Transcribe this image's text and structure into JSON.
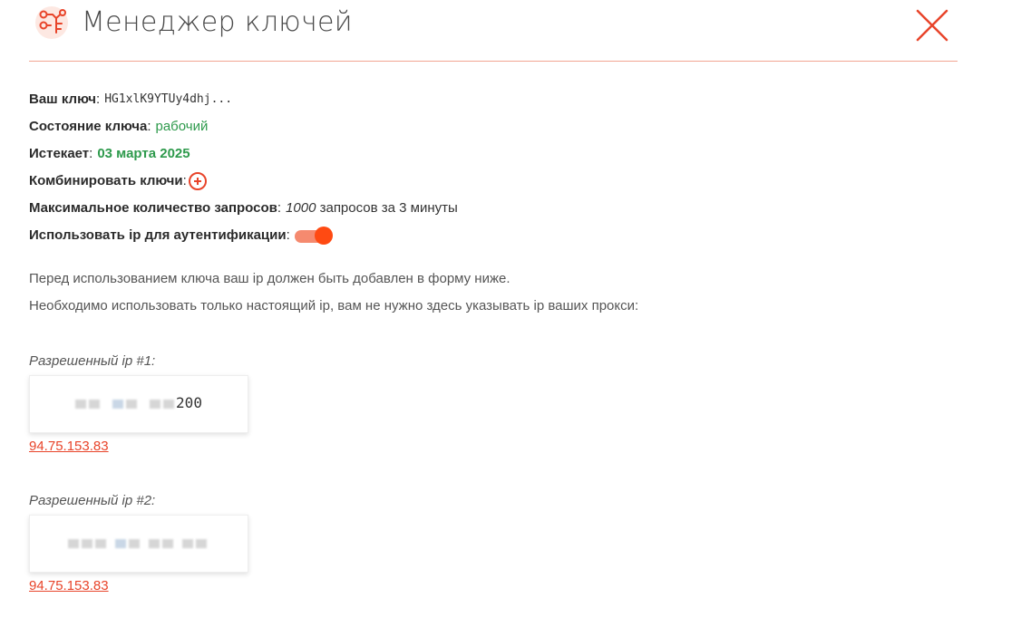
{
  "header": {
    "title": "Менеджер ключей",
    "logo_icon": "key-circuit-icon",
    "close_icon": "close-x-icon",
    "accent_color": "#e8442a"
  },
  "key_info": {
    "key_label": "Ваш ключ",
    "key_value": "HG1xlK9YTUy4dhj...",
    "state_label": "Состояние ключа",
    "state_value": "рабочий",
    "expires_label": "Истекает",
    "expires_value": "03 марта 2025",
    "combine_label": "Комбинировать ключи",
    "combine_icon": "plus-circle-icon",
    "max_label": "Максимальное количество запросов",
    "max_count": "1000",
    "max_rest": "запросов за 3 минуты",
    "ip_auth_label": "Использовать ip для аутентификации",
    "ip_auth_enabled": true
  },
  "notes": {
    "line1": "Перед использованием ключа ваш ip должен быть добавлен в форму ниже.",
    "line2": "Необходимо использовать только настоящий ip, вам не нужно здесь указывать ip ваших прокси:"
  },
  "allowed_ips": [
    {
      "label": "Разрешенный ip #1:",
      "value_visible": "200",
      "link": "94.75.153.83"
    },
    {
      "label": "Разрешенный ip #2:",
      "value_visible": "",
      "link": "94.75.153.83"
    }
  ]
}
